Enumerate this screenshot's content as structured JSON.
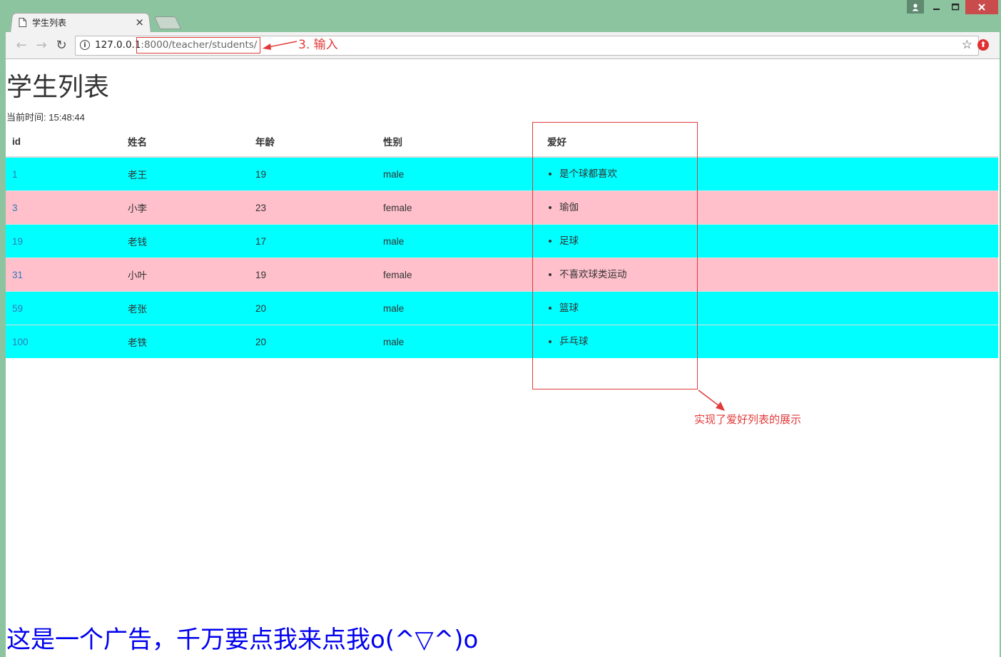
{
  "browser": {
    "tab_title": "学生列表",
    "tab_close": "×",
    "url_host": "127.0.0.1",
    "url_path": ":8000/teacher/students/",
    "info_glyph": "i",
    "star_glyph": "☆",
    "ext_glyph": "⬆",
    "back_glyph": "←",
    "forward_glyph": "→",
    "reload_glyph": "↻"
  },
  "page": {
    "title": "学生列表",
    "time_label": "当前时间",
    "time_value": "15:48:44",
    "headers": {
      "id": "id",
      "name": "姓名",
      "age": "年龄",
      "gender": "性别",
      "hobby": "爱好"
    },
    "rows": [
      {
        "id": "1",
        "name": "老王",
        "age": "19",
        "gender": "male",
        "hobby": "是个球都喜欢"
      },
      {
        "id": "3",
        "name": "小李",
        "age": "23",
        "gender": "female",
        "hobby": "瑜伽"
      },
      {
        "id": "19",
        "name": "老钱",
        "age": "17",
        "gender": "male",
        "hobby": "足球"
      },
      {
        "id": "31",
        "name": "小叶",
        "age": "19",
        "gender": "female",
        "hobby": "不喜欢球类运动"
      },
      {
        "id": "59",
        "name": "老张",
        "age": "20",
        "gender": "male",
        "hobby": "篮球"
      },
      {
        "id": "100",
        "name": "老铁",
        "age": "20",
        "gender": "male",
        "hobby": "乒乓球"
      }
    ],
    "ad_text": "这是一个广告，千万要点我来点我o(^▽^)o"
  },
  "annotations": {
    "url_note": "3. 输入",
    "column_note": "实现了爱好列表的展示"
  },
  "colors": {
    "row_male": "#00ffff",
    "row_female": "#ffc0cb",
    "annotation": "#e23a3a",
    "ad_link": "#0000ee"
  }
}
